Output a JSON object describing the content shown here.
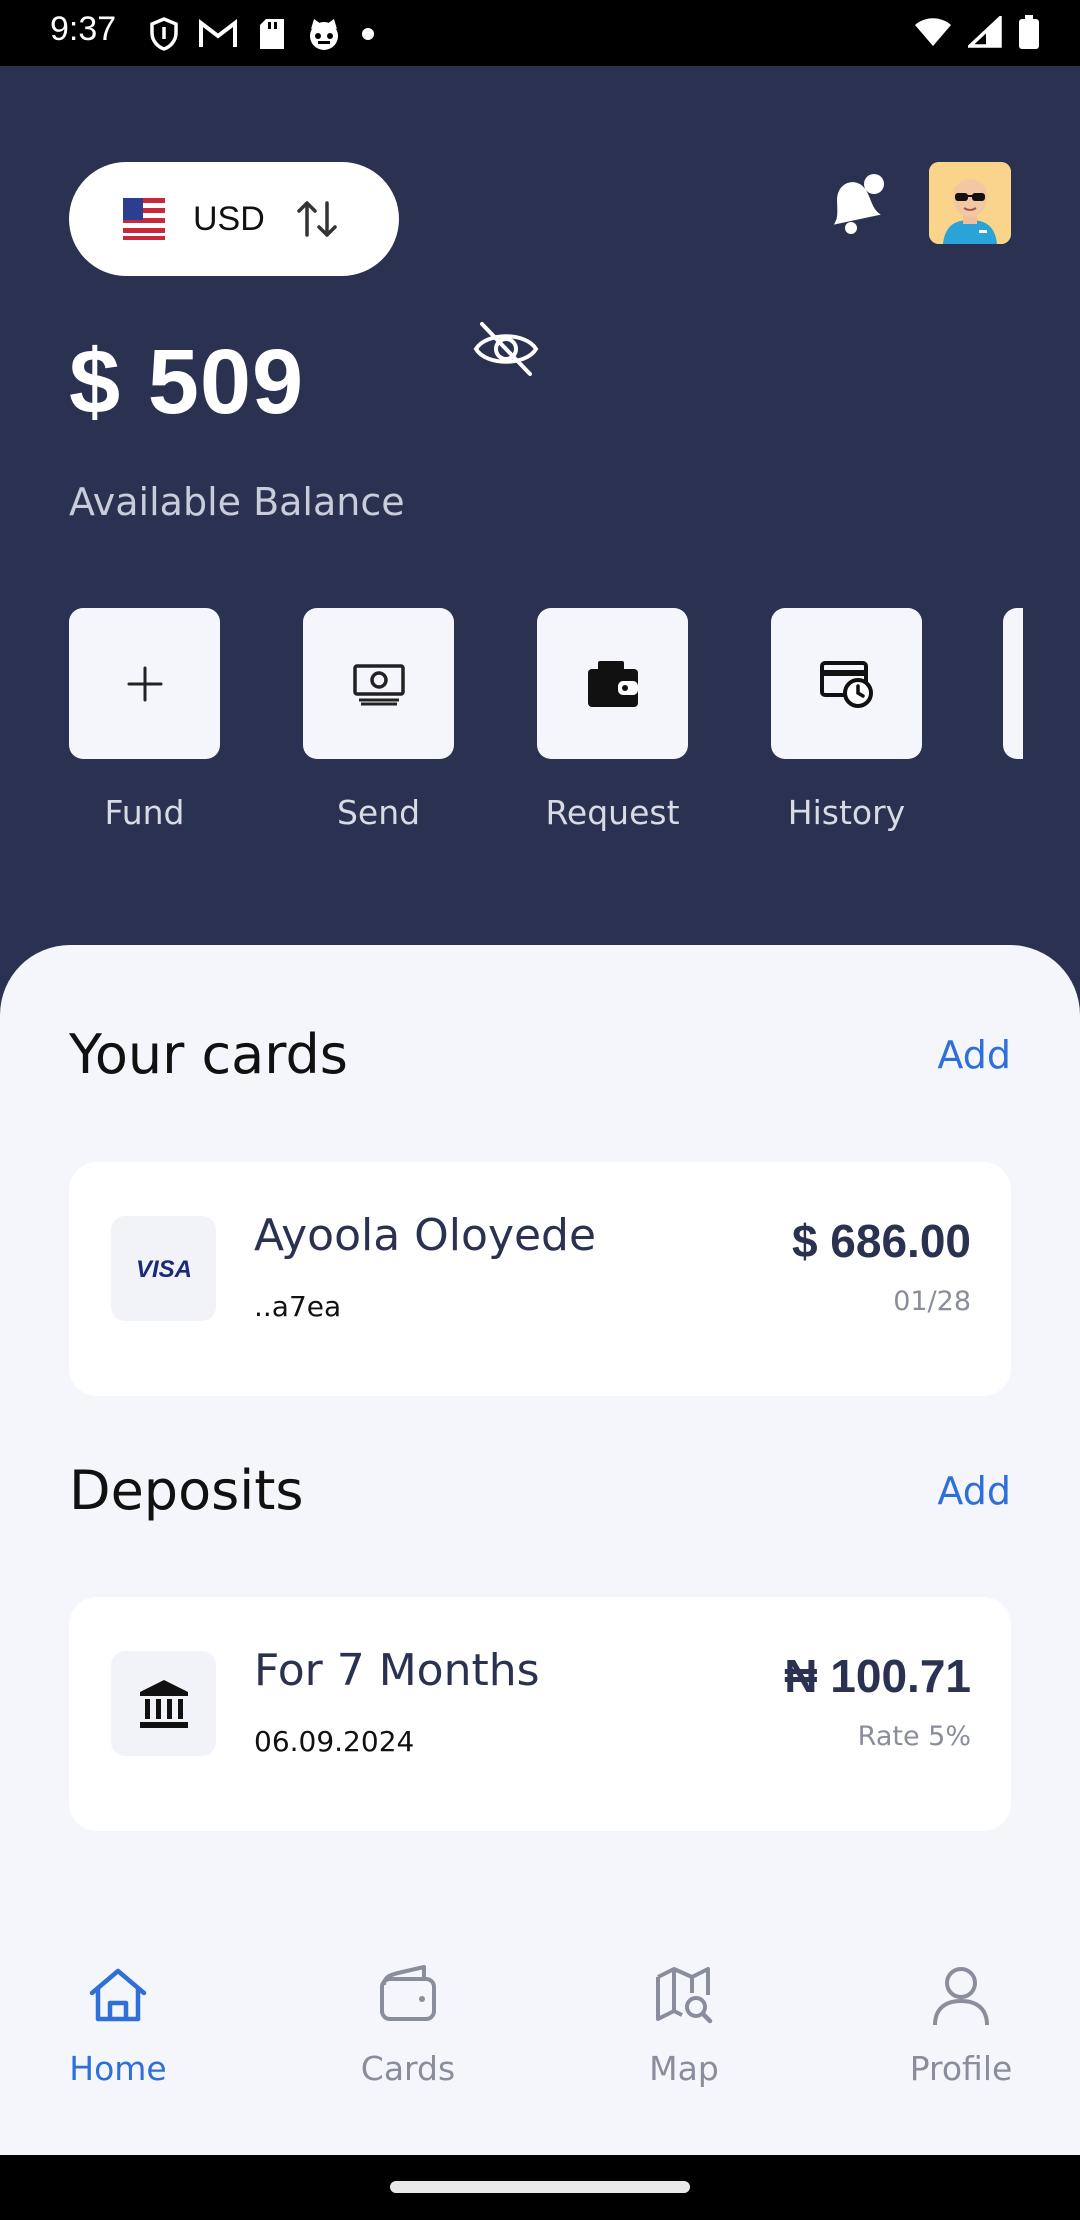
{
  "status_bar": {
    "time": "9:37",
    "left_icons": [
      "shield-icon",
      "gmail-icon",
      "sd-card-icon",
      "cat-face-icon",
      "dot-icon"
    ],
    "right_icons": [
      "wifi-icon",
      "signal-icon",
      "battery-icon"
    ]
  },
  "header": {
    "currency": "USD",
    "flag_icon": "us-flag-icon",
    "swap_icon": "swap-vertical-icon",
    "notification_icon": "bell-icon",
    "avatar": "avatar"
  },
  "balance": {
    "amount": "$ 509",
    "label": "Available Balance",
    "visibility_icon": "eye-off-icon"
  },
  "actions": [
    {
      "label": "Fund",
      "icon": "plus-icon"
    },
    {
      "label": "Send",
      "icon": "cash-icon"
    },
    {
      "label": "Request",
      "icon": "wallet-icon"
    },
    {
      "label": "History",
      "icon": "card-clock-icon"
    }
  ],
  "cards_section": {
    "title": "Your cards",
    "add_label": "Add",
    "card": {
      "brand": "VISA",
      "name": "Ayoola Oloyede",
      "number": "..a7ea",
      "amount": "$ 686.00",
      "expiry": "01/28"
    }
  },
  "deposits_section": {
    "title": "Deposits",
    "add_label": "Add",
    "deposit": {
      "title": "For 7 Months",
      "date": "06.09.2024",
      "amount": "₦ 100.71",
      "rate": "Rate 5%"
    }
  },
  "bottom_nav": [
    {
      "label": "Home",
      "icon": "home-icon",
      "active": true
    },
    {
      "label": "Cards",
      "icon": "wallet-icon",
      "active": false
    },
    {
      "label": "Map",
      "icon": "map-search-icon",
      "active": false
    },
    {
      "label": "Profile",
      "icon": "person-icon",
      "active": false
    }
  ],
  "colors": {
    "header_bg": "#2b3151",
    "sheet_bg": "#f5f6fb",
    "accent": "#2f6fd8"
  }
}
